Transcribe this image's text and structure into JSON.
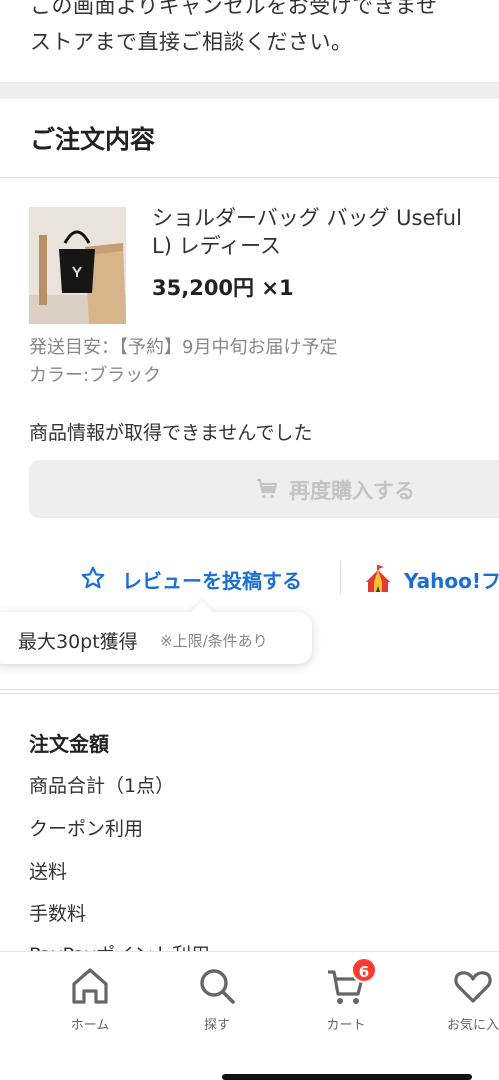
{
  "top_note": {
    "line1": "この画面よりキャンセルをお受けできませ",
    "line2": "ストアまで直接ご相談ください。"
  },
  "order": {
    "section_title": "ご注文内容",
    "product": {
      "name": "ショルダーバッグ バッグ Useful\nL) レディース",
      "price": "35,200円 ×1",
      "shipping_estimate": "発送目安：【予約】9月中旬お届け予定",
      "color": "カラー:ブラック"
    },
    "info_message": "商品情報が取得できませんでした",
    "rebuy_button": {
      "label": "再度購入する",
      "icon": "cart-icon"
    },
    "review_link": {
      "label": "レビューを投稿する",
      "icon": "star-outline-icon"
    },
    "yahoo_link": {
      "label": "Yahoo!フ",
      "icon": "circus-tent-icon"
    },
    "tooltip": {
      "main": "最大30pt獲得",
      "sub": "※上限/条件あり"
    }
  },
  "amount": {
    "title": "注文金額",
    "rows": [
      "商品合計（1点）",
      "クーポン利用",
      "送料",
      "手数料",
      "PayPayポイント利用"
    ]
  },
  "bottom_nav": {
    "items": [
      {
        "label": "ホーム",
        "icon": "home-icon"
      },
      {
        "label": "探す",
        "icon": "search-icon"
      },
      {
        "label": "カート",
        "icon": "cart-icon",
        "badge": "6"
      },
      {
        "label": "お気に入",
        "icon": "heart-icon"
      }
    ]
  },
  "colors": {
    "link_blue": "#1a6fd6",
    "badge_red": "#ff3b30",
    "disabled_gray": "#c4c4c4"
  }
}
